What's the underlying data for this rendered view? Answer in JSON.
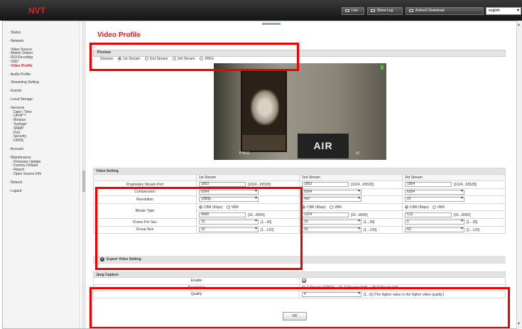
{
  "app": {
    "logo": "NVT"
  },
  "topbar": {
    "live": "Live",
    "show_log": "Show Log",
    "activex": "ActiveX Download",
    "language": "english"
  },
  "sidebar": {
    "items": [
      {
        "label": "Status",
        "sub": false,
        "gap": false,
        "active": false
      },
      {
        "label": "Network",
        "sub": false,
        "gap": true,
        "active": false
      },
      {
        "label": "Video Source",
        "sub": false,
        "gap": true,
        "active": false
      },
      {
        "label": "Motion Detect",
        "sub": false,
        "gap": false,
        "active": false
      },
      {
        "label": "ROI Encoding",
        "sub": false,
        "gap": false,
        "active": false
      },
      {
        "label": "OSD",
        "sub": false,
        "gap": false,
        "active": false
      },
      {
        "label": "Video Profile",
        "sub": false,
        "gap": false,
        "active": true
      },
      {
        "label": "Audio Profile",
        "sub": false,
        "gap": true,
        "active": false
      },
      {
        "label": "Streaming Setting",
        "sub": false,
        "gap": true,
        "active": false
      },
      {
        "label": "Events",
        "sub": false,
        "gap": true,
        "active": false
      },
      {
        "label": "Local Storage",
        "sub": false,
        "gap": true,
        "active": false
      },
      {
        "label": "Services",
        "sub": false,
        "gap": true,
        "active": false
      },
      {
        "label": "Date / Time",
        "sub": true,
        "gap": false,
        "active": false
      },
      {
        "label": "UPnP™",
        "sub": true,
        "gap": false,
        "active": false
      },
      {
        "label": "Bonjour",
        "sub": true,
        "gap": false,
        "active": false
      },
      {
        "label": "Syslogd",
        "sub": true,
        "gap": false,
        "active": false
      },
      {
        "label": "SNMP",
        "sub": true,
        "gap": false,
        "active": false
      },
      {
        "label": "Port",
        "sub": true,
        "gap": false,
        "active": false
      },
      {
        "label": "Security",
        "sub": true,
        "gap": false,
        "active": false
      },
      {
        "label": "DDNS",
        "sub": true,
        "gap": false,
        "active": false
      },
      {
        "label": "Account",
        "sub": false,
        "gap": true,
        "active": false
      },
      {
        "label": "Maintenance",
        "sub": false,
        "gap": true,
        "active": false
      },
      {
        "label": "Firmware Update",
        "sub": true,
        "gap": false,
        "active": false
      },
      {
        "label": "Factory Default",
        "sub": true,
        "gap": false,
        "active": false
      },
      {
        "label": "Report",
        "sub": true,
        "gap": false,
        "active": false
      },
      {
        "label": "Open Source Info",
        "sub": true,
        "gap": false,
        "active": false
      },
      {
        "label": "Reboot",
        "sub": false,
        "gap": true,
        "active": false
      },
      {
        "label": "Logout",
        "sub": false,
        "gap": true,
        "active": false
      }
    ]
  },
  "main": {
    "title": "Video Profile",
    "preview": {
      "header": "Preview",
      "streams_label": "Streams",
      "options": [
        "1st Stream",
        "2nd Stream",
        "3rd Stream",
        "JPEG"
      ],
      "selected": 0
    },
    "video": {
      "banner": "AIR FRANCE",
      "osd_left": "PHILE",
      "osd_right": "x2"
    },
    "video_setting": {
      "header": "Video Setting",
      "columns": [
        "1st Stream",
        "2nd Stream",
        "3rd Stream"
      ],
      "rows": {
        "port": {
          "label": "Proprietary Stream Port",
          "values": [
            "1852",
            "1853",
            "1854"
          ],
          "range": "[1024...65535]"
        },
        "compression": {
          "label": "Compression",
          "values": [
            "h264",
            "h264",
            "h264"
          ]
        },
        "resolution": {
          "label": "Resolution",
          "values": [
            "1080p",
            "4cif",
            "cif"
          ]
        },
        "bitrate": {
          "label": "Bitrate Type",
          "cbr": "CBR (Kbps)",
          "vbr": "VBR",
          "values": [
            "4096",
            "1024",
            "512"
          ],
          "range": "[32...8000]"
        },
        "fps": {
          "label": "Frame Per Sec",
          "values": [
            "15",
            "15",
            "5"
          ],
          "range": "[1...30]"
        },
        "gop": {
          "label": "Group Size",
          "values": [
            "15",
            "30",
            "60"
          ],
          "range": "[1...120]"
        }
      }
    },
    "expert": "Expert Video Setting",
    "jpeg": {
      "header": "Jpeg Capture",
      "enable_label": "Enable",
      "resolution_label": "Resolution",
      "resolution_options": [
        "1 Stream (1080p)",
        "2 Stream (4cif)",
        "3 Stream (cif)"
      ],
      "resolution_selected": 2,
      "quality_label": "Quality",
      "quality_value": "4",
      "quality_hint": "[1...6] (The higher value is the higher video quality.)"
    },
    "ok": "OK"
  },
  "colors": {
    "accent": "#e11b22",
    "highlight": "#ee0000",
    "topbar": "#1e1e1e"
  }
}
